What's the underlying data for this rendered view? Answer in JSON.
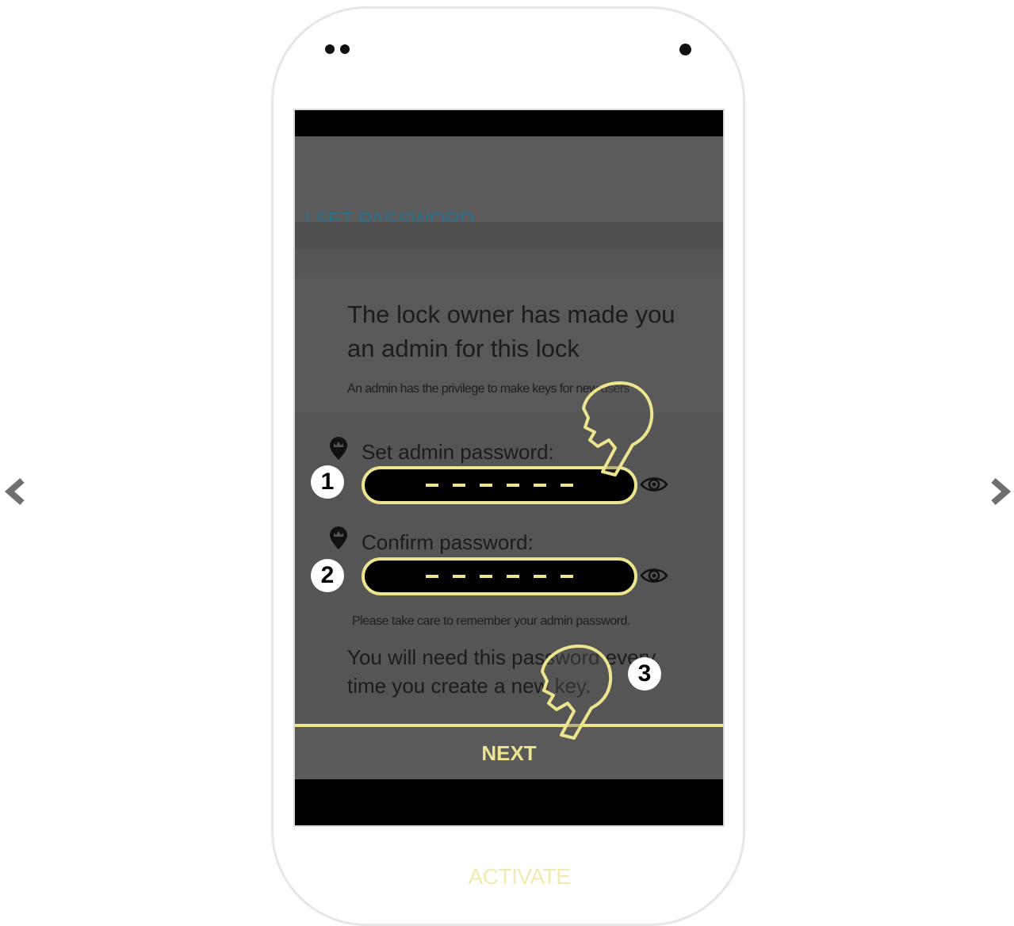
{
  "nav": {
    "prev_icon": "chevron-left-icon",
    "next_icon": "chevron-right-icon"
  },
  "screen": {
    "appbar_title": "| SET PASSWORD",
    "heading": "The lock owner has made you an admin for this lock",
    "subtext": "An admin has the privilege to make keys for new users",
    "fields": [
      {
        "label": "Set admin password:",
        "badge": "1",
        "icon": "crown-pin-icon",
        "eye_icon": "eye-icon"
      },
      {
        "label": "Confirm password:",
        "badge": "2",
        "icon": "crown-pin-icon",
        "eye_icon": "eye-icon"
      }
    ],
    "note": "Please take care to remember your admin password.",
    "warning": "You will need this password every time you create a new key.",
    "next_badge": "3",
    "next_label": "NEXT"
  },
  "activate_label": "ACTIVATE",
  "colors": {
    "accent": "#ece58e",
    "title": "#2a6f89",
    "screen_bg": "#555555",
    "activate": "#f1ebb0"
  }
}
